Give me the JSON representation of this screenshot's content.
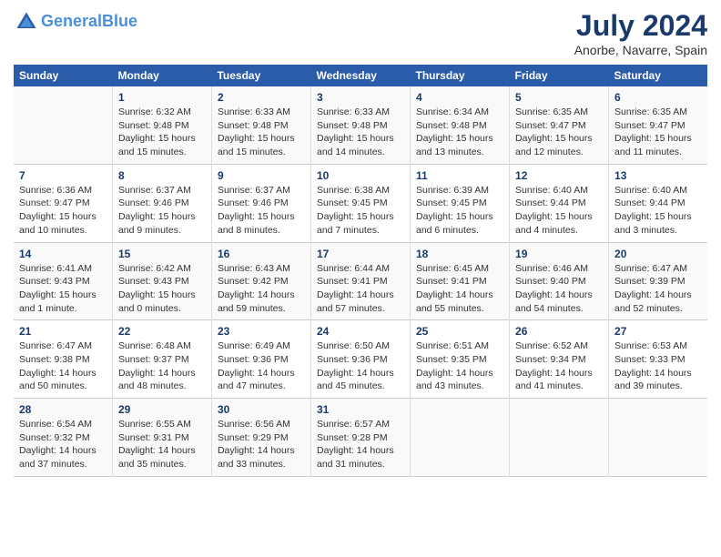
{
  "header": {
    "logo_line1": "General",
    "logo_line2": "Blue",
    "title": "July 2024",
    "subtitle": "Anorbe, Navarre, Spain"
  },
  "days_of_week": [
    "Sunday",
    "Monday",
    "Tuesday",
    "Wednesday",
    "Thursday",
    "Friday",
    "Saturday"
  ],
  "weeks": [
    [
      {
        "day": "",
        "info": ""
      },
      {
        "day": "1",
        "info": "Sunrise: 6:32 AM\nSunset: 9:48 PM\nDaylight: 15 hours\nand 15 minutes."
      },
      {
        "day": "2",
        "info": "Sunrise: 6:33 AM\nSunset: 9:48 PM\nDaylight: 15 hours\nand 15 minutes."
      },
      {
        "day": "3",
        "info": "Sunrise: 6:33 AM\nSunset: 9:48 PM\nDaylight: 15 hours\nand 14 minutes."
      },
      {
        "day": "4",
        "info": "Sunrise: 6:34 AM\nSunset: 9:48 PM\nDaylight: 15 hours\nand 13 minutes."
      },
      {
        "day": "5",
        "info": "Sunrise: 6:35 AM\nSunset: 9:47 PM\nDaylight: 15 hours\nand 12 minutes."
      },
      {
        "day": "6",
        "info": "Sunrise: 6:35 AM\nSunset: 9:47 PM\nDaylight: 15 hours\nand 11 minutes."
      }
    ],
    [
      {
        "day": "7",
        "info": "Sunrise: 6:36 AM\nSunset: 9:47 PM\nDaylight: 15 hours\nand 10 minutes."
      },
      {
        "day": "8",
        "info": "Sunrise: 6:37 AM\nSunset: 9:46 PM\nDaylight: 15 hours\nand 9 minutes."
      },
      {
        "day": "9",
        "info": "Sunrise: 6:37 AM\nSunset: 9:46 PM\nDaylight: 15 hours\nand 8 minutes."
      },
      {
        "day": "10",
        "info": "Sunrise: 6:38 AM\nSunset: 9:45 PM\nDaylight: 15 hours\nand 7 minutes."
      },
      {
        "day": "11",
        "info": "Sunrise: 6:39 AM\nSunset: 9:45 PM\nDaylight: 15 hours\nand 6 minutes."
      },
      {
        "day": "12",
        "info": "Sunrise: 6:40 AM\nSunset: 9:44 PM\nDaylight: 15 hours\nand 4 minutes."
      },
      {
        "day": "13",
        "info": "Sunrise: 6:40 AM\nSunset: 9:44 PM\nDaylight: 15 hours\nand 3 minutes."
      }
    ],
    [
      {
        "day": "14",
        "info": "Sunrise: 6:41 AM\nSunset: 9:43 PM\nDaylight: 15 hours\nand 1 minute."
      },
      {
        "day": "15",
        "info": "Sunrise: 6:42 AM\nSunset: 9:43 PM\nDaylight: 15 hours\nand 0 minutes."
      },
      {
        "day": "16",
        "info": "Sunrise: 6:43 AM\nSunset: 9:42 PM\nDaylight: 14 hours\nand 59 minutes."
      },
      {
        "day": "17",
        "info": "Sunrise: 6:44 AM\nSunset: 9:41 PM\nDaylight: 14 hours\nand 57 minutes."
      },
      {
        "day": "18",
        "info": "Sunrise: 6:45 AM\nSunset: 9:41 PM\nDaylight: 14 hours\nand 55 minutes."
      },
      {
        "day": "19",
        "info": "Sunrise: 6:46 AM\nSunset: 9:40 PM\nDaylight: 14 hours\nand 54 minutes."
      },
      {
        "day": "20",
        "info": "Sunrise: 6:47 AM\nSunset: 9:39 PM\nDaylight: 14 hours\nand 52 minutes."
      }
    ],
    [
      {
        "day": "21",
        "info": "Sunrise: 6:47 AM\nSunset: 9:38 PM\nDaylight: 14 hours\nand 50 minutes."
      },
      {
        "day": "22",
        "info": "Sunrise: 6:48 AM\nSunset: 9:37 PM\nDaylight: 14 hours\nand 48 minutes."
      },
      {
        "day": "23",
        "info": "Sunrise: 6:49 AM\nSunset: 9:36 PM\nDaylight: 14 hours\nand 47 minutes."
      },
      {
        "day": "24",
        "info": "Sunrise: 6:50 AM\nSunset: 9:36 PM\nDaylight: 14 hours\nand 45 minutes."
      },
      {
        "day": "25",
        "info": "Sunrise: 6:51 AM\nSunset: 9:35 PM\nDaylight: 14 hours\nand 43 minutes."
      },
      {
        "day": "26",
        "info": "Sunrise: 6:52 AM\nSunset: 9:34 PM\nDaylight: 14 hours\nand 41 minutes."
      },
      {
        "day": "27",
        "info": "Sunrise: 6:53 AM\nSunset: 9:33 PM\nDaylight: 14 hours\nand 39 minutes."
      }
    ],
    [
      {
        "day": "28",
        "info": "Sunrise: 6:54 AM\nSunset: 9:32 PM\nDaylight: 14 hours\nand 37 minutes."
      },
      {
        "day": "29",
        "info": "Sunrise: 6:55 AM\nSunset: 9:31 PM\nDaylight: 14 hours\nand 35 minutes."
      },
      {
        "day": "30",
        "info": "Sunrise: 6:56 AM\nSunset: 9:29 PM\nDaylight: 14 hours\nand 33 minutes."
      },
      {
        "day": "31",
        "info": "Sunrise: 6:57 AM\nSunset: 9:28 PM\nDaylight: 14 hours\nand 31 minutes."
      },
      {
        "day": "",
        "info": ""
      },
      {
        "day": "",
        "info": ""
      },
      {
        "day": "",
        "info": ""
      }
    ]
  ]
}
